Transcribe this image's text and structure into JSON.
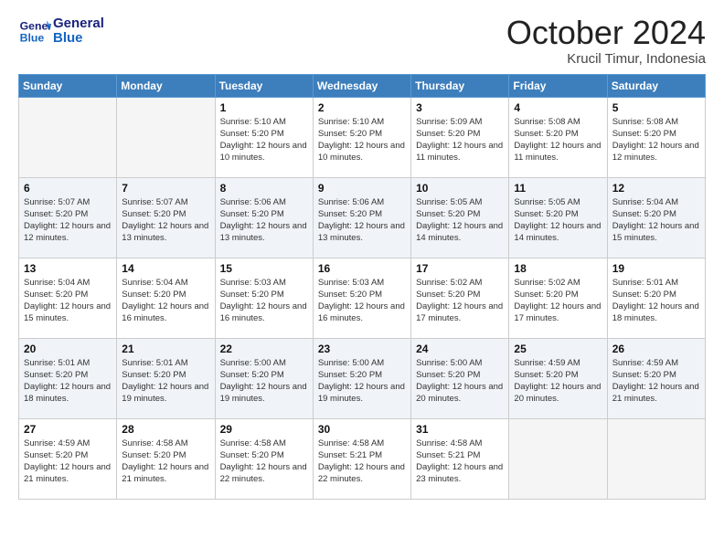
{
  "header": {
    "logo_line1": "General",
    "logo_line2": "Blue",
    "month": "October 2024",
    "location": "Krucil Timur, Indonesia"
  },
  "weekdays": [
    "Sunday",
    "Monday",
    "Tuesday",
    "Wednesday",
    "Thursday",
    "Friday",
    "Saturday"
  ],
  "weeks": [
    [
      {
        "day": "",
        "sunrise": "",
        "sunset": "",
        "daylight": "",
        "empty": true
      },
      {
        "day": "",
        "sunrise": "",
        "sunset": "",
        "daylight": "",
        "empty": true
      },
      {
        "day": "1",
        "sunrise": "Sunrise: 5:10 AM",
        "sunset": "Sunset: 5:20 PM",
        "daylight": "Daylight: 12 hours and 10 minutes."
      },
      {
        "day": "2",
        "sunrise": "Sunrise: 5:10 AM",
        "sunset": "Sunset: 5:20 PM",
        "daylight": "Daylight: 12 hours and 10 minutes."
      },
      {
        "day": "3",
        "sunrise": "Sunrise: 5:09 AM",
        "sunset": "Sunset: 5:20 PM",
        "daylight": "Daylight: 12 hours and 11 minutes."
      },
      {
        "day": "4",
        "sunrise": "Sunrise: 5:08 AM",
        "sunset": "Sunset: 5:20 PM",
        "daylight": "Daylight: 12 hours and 11 minutes."
      },
      {
        "day": "5",
        "sunrise": "Sunrise: 5:08 AM",
        "sunset": "Sunset: 5:20 PM",
        "daylight": "Daylight: 12 hours and 12 minutes."
      }
    ],
    [
      {
        "day": "6",
        "sunrise": "Sunrise: 5:07 AM",
        "sunset": "Sunset: 5:20 PM",
        "daylight": "Daylight: 12 hours and 12 minutes."
      },
      {
        "day": "7",
        "sunrise": "Sunrise: 5:07 AM",
        "sunset": "Sunset: 5:20 PM",
        "daylight": "Daylight: 12 hours and 13 minutes."
      },
      {
        "day": "8",
        "sunrise": "Sunrise: 5:06 AM",
        "sunset": "Sunset: 5:20 PM",
        "daylight": "Daylight: 12 hours and 13 minutes."
      },
      {
        "day": "9",
        "sunrise": "Sunrise: 5:06 AM",
        "sunset": "Sunset: 5:20 PM",
        "daylight": "Daylight: 12 hours and 13 minutes."
      },
      {
        "day": "10",
        "sunrise": "Sunrise: 5:05 AM",
        "sunset": "Sunset: 5:20 PM",
        "daylight": "Daylight: 12 hours and 14 minutes."
      },
      {
        "day": "11",
        "sunrise": "Sunrise: 5:05 AM",
        "sunset": "Sunset: 5:20 PM",
        "daylight": "Daylight: 12 hours and 14 minutes."
      },
      {
        "day": "12",
        "sunrise": "Sunrise: 5:04 AM",
        "sunset": "Sunset: 5:20 PM",
        "daylight": "Daylight: 12 hours and 15 minutes."
      }
    ],
    [
      {
        "day": "13",
        "sunrise": "Sunrise: 5:04 AM",
        "sunset": "Sunset: 5:20 PM",
        "daylight": "Daylight: 12 hours and 15 minutes."
      },
      {
        "day": "14",
        "sunrise": "Sunrise: 5:04 AM",
        "sunset": "Sunset: 5:20 PM",
        "daylight": "Daylight: 12 hours and 16 minutes."
      },
      {
        "day": "15",
        "sunrise": "Sunrise: 5:03 AM",
        "sunset": "Sunset: 5:20 PM",
        "daylight": "Daylight: 12 hours and 16 minutes."
      },
      {
        "day": "16",
        "sunrise": "Sunrise: 5:03 AM",
        "sunset": "Sunset: 5:20 PM",
        "daylight": "Daylight: 12 hours and 16 minutes."
      },
      {
        "day": "17",
        "sunrise": "Sunrise: 5:02 AM",
        "sunset": "Sunset: 5:20 PM",
        "daylight": "Daylight: 12 hours and 17 minutes."
      },
      {
        "day": "18",
        "sunrise": "Sunrise: 5:02 AM",
        "sunset": "Sunset: 5:20 PM",
        "daylight": "Daylight: 12 hours and 17 minutes."
      },
      {
        "day": "19",
        "sunrise": "Sunrise: 5:01 AM",
        "sunset": "Sunset: 5:20 PM",
        "daylight": "Daylight: 12 hours and 18 minutes."
      }
    ],
    [
      {
        "day": "20",
        "sunrise": "Sunrise: 5:01 AM",
        "sunset": "Sunset: 5:20 PM",
        "daylight": "Daylight: 12 hours and 18 minutes."
      },
      {
        "day": "21",
        "sunrise": "Sunrise: 5:01 AM",
        "sunset": "Sunset: 5:20 PM",
        "daylight": "Daylight: 12 hours and 19 minutes."
      },
      {
        "day": "22",
        "sunrise": "Sunrise: 5:00 AM",
        "sunset": "Sunset: 5:20 PM",
        "daylight": "Daylight: 12 hours and 19 minutes."
      },
      {
        "day": "23",
        "sunrise": "Sunrise: 5:00 AM",
        "sunset": "Sunset: 5:20 PM",
        "daylight": "Daylight: 12 hours and 19 minutes."
      },
      {
        "day": "24",
        "sunrise": "Sunrise: 5:00 AM",
        "sunset": "Sunset: 5:20 PM",
        "daylight": "Daylight: 12 hours and 20 minutes."
      },
      {
        "day": "25",
        "sunrise": "Sunrise: 4:59 AM",
        "sunset": "Sunset: 5:20 PM",
        "daylight": "Daylight: 12 hours and 20 minutes."
      },
      {
        "day": "26",
        "sunrise": "Sunrise: 4:59 AM",
        "sunset": "Sunset: 5:20 PM",
        "daylight": "Daylight: 12 hours and 21 minutes."
      }
    ],
    [
      {
        "day": "27",
        "sunrise": "Sunrise: 4:59 AM",
        "sunset": "Sunset: 5:20 PM",
        "daylight": "Daylight: 12 hours and 21 minutes."
      },
      {
        "day": "28",
        "sunrise": "Sunrise: 4:58 AM",
        "sunset": "Sunset: 5:20 PM",
        "daylight": "Daylight: 12 hours and 21 minutes."
      },
      {
        "day": "29",
        "sunrise": "Sunrise: 4:58 AM",
        "sunset": "Sunset: 5:20 PM",
        "daylight": "Daylight: 12 hours and 22 minutes."
      },
      {
        "day": "30",
        "sunrise": "Sunrise: 4:58 AM",
        "sunset": "Sunset: 5:21 PM",
        "daylight": "Daylight: 12 hours and 22 minutes."
      },
      {
        "day": "31",
        "sunrise": "Sunrise: 4:58 AM",
        "sunset": "Sunset: 5:21 PM",
        "daylight": "Daylight: 12 hours and 23 minutes."
      },
      {
        "day": "",
        "sunrise": "",
        "sunset": "",
        "daylight": "",
        "empty": true
      },
      {
        "day": "",
        "sunrise": "",
        "sunset": "",
        "daylight": "",
        "empty": true
      }
    ]
  ]
}
